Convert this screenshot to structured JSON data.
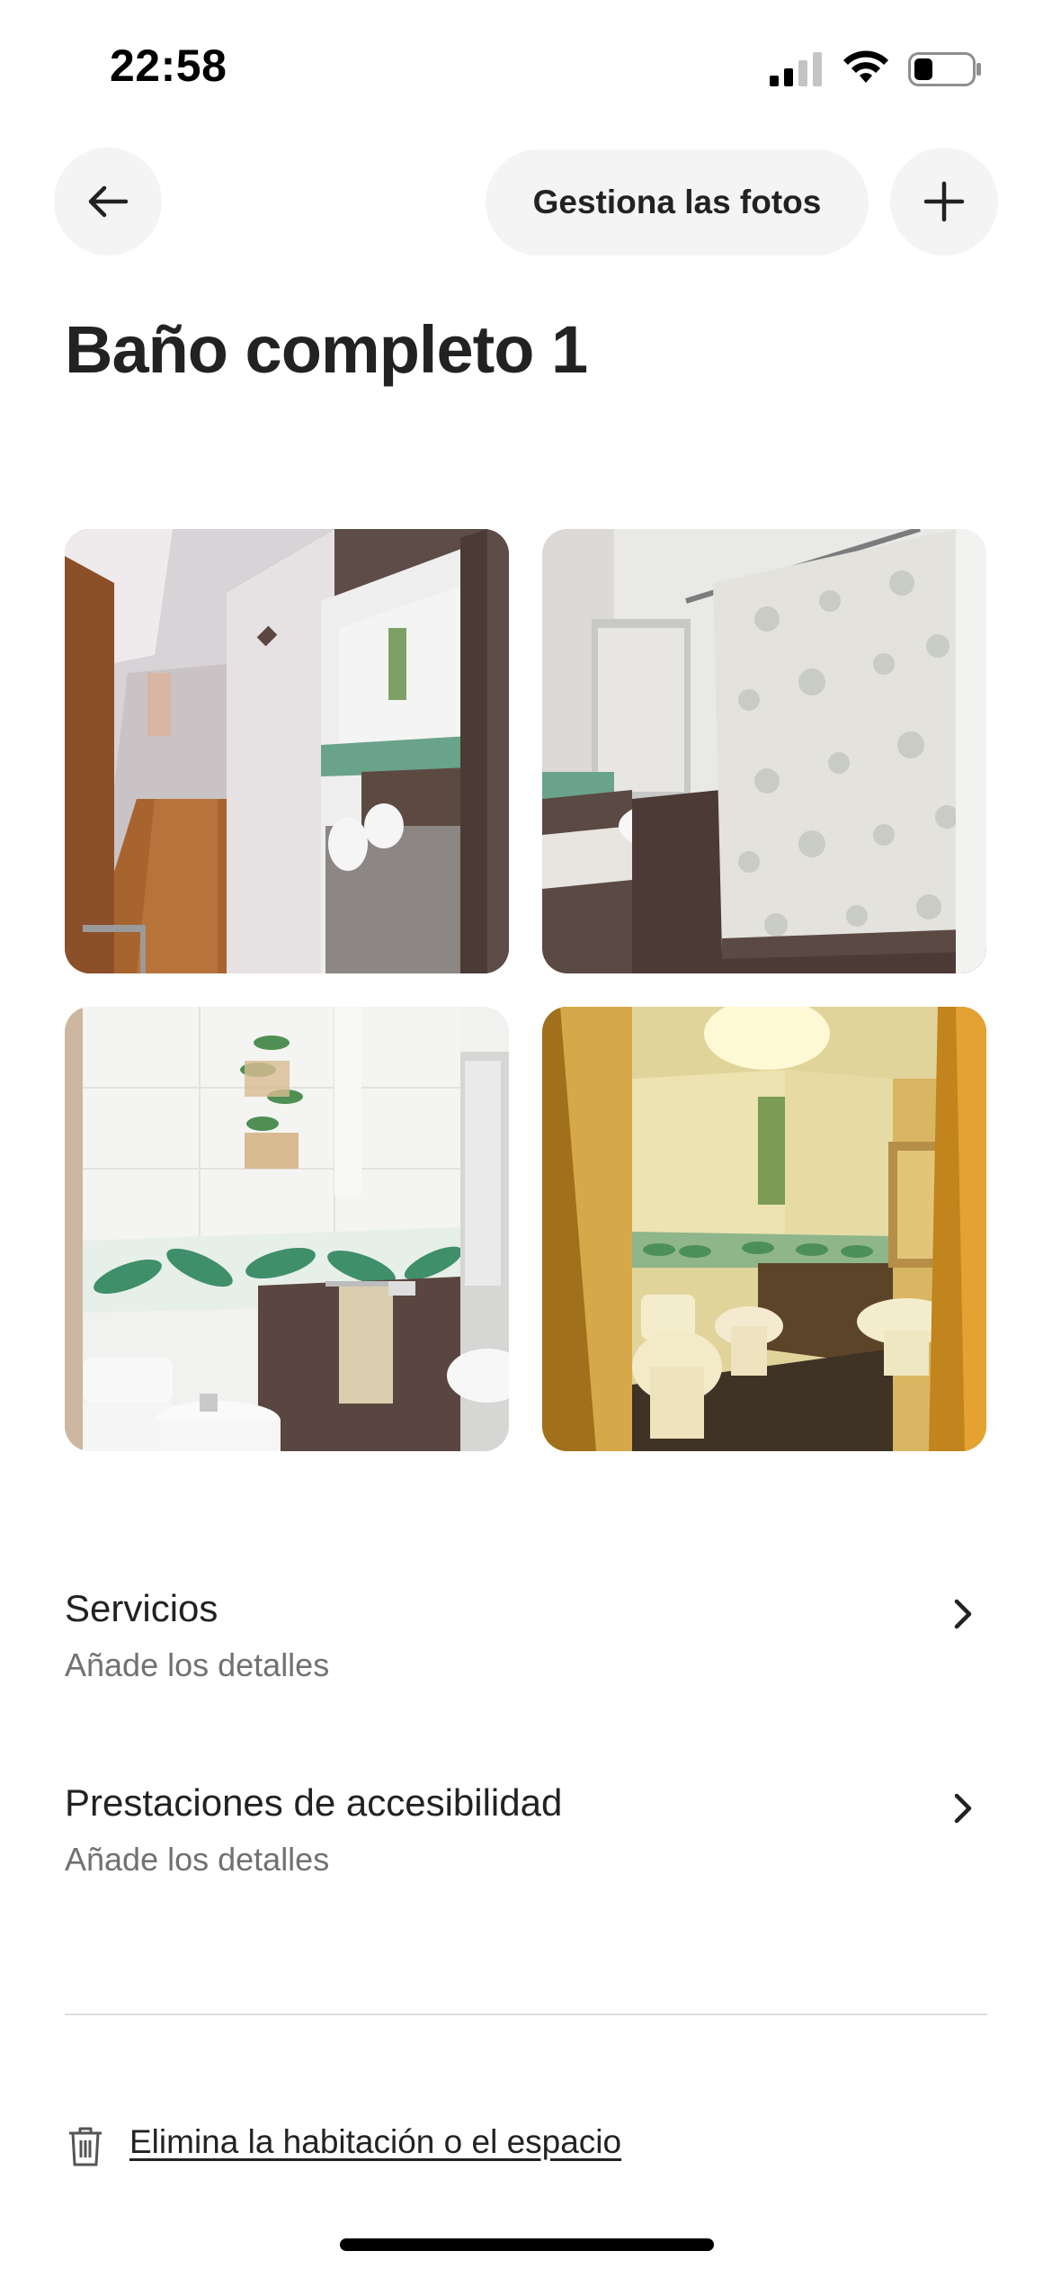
{
  "status_bar": {
    "time": "22:58",
    "signal_icon": "cellular-signal-icon",
    "wifi_icon": "wifi-icon",
    "battery_icon": "battery-icon",
    "battery_level": 0.3
  },
  "header": {
    "back_icon": "arrow-left-icon",
    "manage_photos_label": "Gestiona las fotos",
    "add_icon": "plus-icon"
  },
  "title": "Baño completo 1",
  "photos": [
    {
      "subject": "hallway with open bathroom door"
    },
    {
      "subject": "shower curtain and washbasin"
    },
    {
      "subject": "toilet, bidet and towel rail with leaf wall border"
    },
    {
      "subject": "bathroom in warm lighting with mirror"
    }
  ],
  "rows": [
    {
      "title": "Servicios",
      "subtitle": "Añade los detalles",
      "icon": "chevron-right-icon"
    },
    {
      "title": "Prestaciones de accesibilidad",
      "subtitle": "Añade los detalles",
      "icon": "chevron-right-icon"
    }
  ],
  "delete": {
    "icon": "trash-icon",
    "label": "Elimina la habitación o el espacio"
  },
  "colors": {
    "text": "#222222",
    "secondary_text": "#717171",
    "button_bg": "#f4f4f4",
    "divider": "#dddddd"
  }
}
